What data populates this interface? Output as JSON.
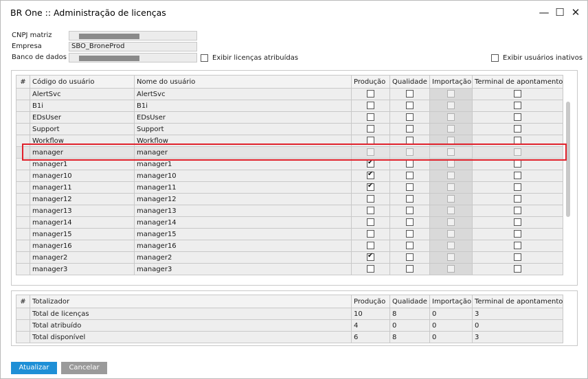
{
  "window": {
    "title": "BR One :: Administração de licenças"
  },
  "header": {
    "cnpj_label": "CNPJ matriz",
    "empresa_label": "Empresa",
    "empresa_value": "SBO_BroneProd",
    "banco_label": "Banco de dados",
    "exibir_atribuidas_label": "Exibir licenças atribuídas",
    "exibir_inativos_label": "Exibir usuários inativos"
  },
  "users_table": {
    "columns": [
      "#",
      "Código do usuário",
      "Nome do usuário",
      "Produção",
      "Qualidade",
      "Importação",
      "Terminal de apontamento"
    ],
    "rows": [
      {
        "code": "AlertSvc",
        "name": "AlertSvc",
        "producao": false,
        "qualidade": false,
        "terminal": false
      },
      {
        "code": "B1i",
        "name": "B1i",
        "producao": false,
        "qualidade": false,
        "terminal": false
      },
      {
        "code": "EDsUser",
        "name": "EDsUser",
        "producao": false,
        "qualidade": false,
        "terminal": false
      },
      {
        "code": "Support",
        "name": "Support",
        "producao": false,
        "qualidade": false,
        "terminal": false
      },
      {
        "code": "Workflow",
        "name": "Workflow",
        "producao": false,
        "qualidade": false,
        "terminal": false
      },
      {
        "code": "manager",
        "name": "manager",
        "producao": false,
        "qualidade": false,
        "terminal": false,
        "disabled": true
      },
      {
        "code": "manager1",
        "name": "manager1",
        "producao": true,
        "qualidade": false,
        "terminal": false
      },
      {
        "code": "manager10",
        "name": "manager10",
        "producao": true,
        "qualidade": false,
        "terminal": false
      },
      {
        "code": "manager11",
        "name": "manager11",
        "producao": true,
        "qualidade": false,
        "terminal": false
      },
      {
        "code": "manager12",
        "name": "manager12",
        "producao": false,
        "qualidade": false,
        "terminal": false
      },
      {
        "code": "manager13",
        "name": "manager13",
        "producao": false,
        "qualidade": false,
        "terminal": false
      },
      {
        "code": "manager14",
        "name": "manager14",
        "producao": false,
        "qualidade": false,
        "terminal": false
      },
      {
        "code": "manager15",
        "name": "manager15",
        "producao": false,
        "qualidade": false,
        "terminal": false
      },
      {
        "code": "manager16",
        "name": "manager16",
        "producao": false,
        "qualidade": false,
        "terminal": false
      },
      {
        "code": "manager2",
        "name": "manager2",
        "producao": true,
        "qualidade": false,
        "terminal": false
      },
      {
        "code": "manager3",
        "name": "manager3",
        "producao": false,
        "qualidade": false,
        "terminal": false
      }
    ]
  },
  "totals_table": {
    "columns": [
      "#",
      "Totalizador",
      "Produção",
      "Qualidade",
      "Importação",
      "Terminal de apontamento"
    ],
    "rows": [
      {
        "label": "Total de licenças",
        "producao": "10",
        "qualidade": "8",
        "importacao": "0",
        "terminal": "3"
      },
      {
        "label": "Total atribuído",
        "producao": "4",
        "qualidade": "0",
        "importacao": "0",
        "terminal": "0"
      },
      {
        "label": "Total disponível",
        "producao": "6",
        "qualidade": "8",
        "importacao": "0",
        "terminal": "3"
      }
    ]
  },
  "buttons": {
    "atualizar": "Atualizar",
    "cancelar": "Cancelar"
  },
  "colors": {
    "primary_button": "#1e8fd6",
    "highlight": "#e0202a",
    "secondary_button": "#9a9a9a"
  },
  "icons": [
    "minimize-icon",
    "maximize-icon",
    "close-icon",
    "check-icon"
  ]
}
